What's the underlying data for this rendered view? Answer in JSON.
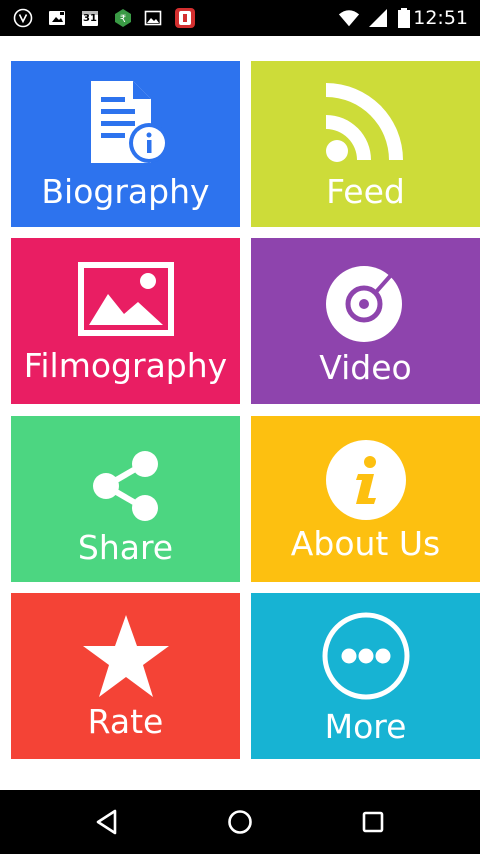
{
  "status_bar": {
    "time": "12:51",
    "calendar_day": "31",
    "icons": [
      "viber-icon",
      "image-notification-icon",
      "calendar-icon",
      "store-icon",
      "gallery-icon",
      "app-notification-icon",
      "wifi-icon",
      "signal-icon",
      "battery-icon"
    ]
  },
  "tiles": [
    {
      "label": "Biography",
      "color": "#2d73ee",
      "icon": "document-info-icon"
    },
    {
      "label": "Feed",
      "color": "#cddc39",
      "icon": "rss-icon"
    },
    {
      "label": "Filmography",
      "color": "#e91e63",
      "icon": "picture-icon"
    },
    {
      "label": "Video",
      "color": "#8e44ad",
      "icon": "disc-icon"
    },
    {
      "label": "Share",
      "color": "#4cd681",
      "icon": "share-icon"
    },
    {
      "label": "About Us",
      "color": "#fdc010",
      "icon": "info-icon"
    },
    {
      "label": "Rate",
      "color": "#f44336",
      "icon": "star-icon"
    },
    {
      "label": "More",
      "color": "#17b3d3",
      "icon": "more-icon"
    }
  ],
  "nav_bar": {
    "buttons": [
      "back-icon",
      "home-icon",
      "recents-icon"
    ]
  }
}
